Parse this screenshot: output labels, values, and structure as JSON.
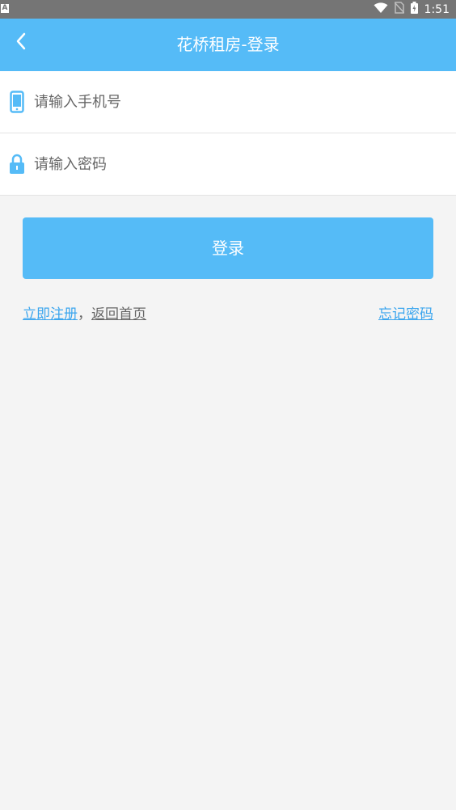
{
  "status_bar": {
    "indicator": "A",
    "time": "1:51",
    "icons": [
      "wifi-icon",
      "no-sim-icon",
      "battery-charging-icon"
    ]
  },
  "app_bar": {
    "title": "花桥租房-登录",
    "back_icon": "back-arrow-icon"
  },
  "form": {
    "phone": {
      "placeholder": "请输入手机号",
      "value": "",
      "icon": "phone-icon"
    },
    "password": {
      "placeholder": "请输入密码",
      "value": "",
      "icon": "lock-icon"
    },
    "login_label": "登录"
  },
  "links": {
    "register": "立即注册",
    "separator": "，",
    "home": "返回首页",
    "forgot": "忘记密码"
  },
  "colors": {
    "primary": "#55bbf7",
    "link": "#3aa5ee",
    "background": "#f4f4f4",
    "status_bar": "#757575"
  }
}
